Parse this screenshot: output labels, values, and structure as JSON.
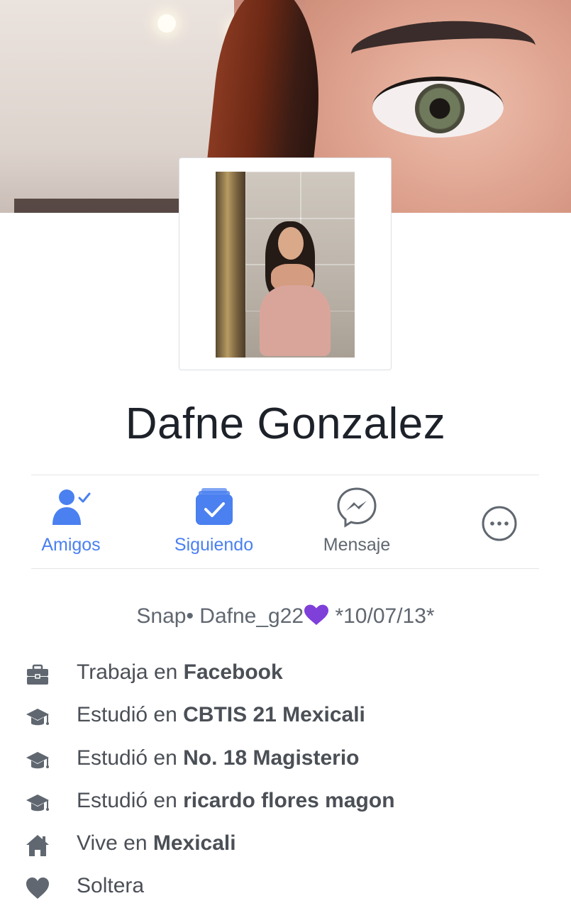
{
  "profile": {
    "name": "Dafne Gonzalez",
    "bio_prefix": "Snap• Dafne_g22",
    "bio_suffix": " *10/07/13*"
  },
  "actions": {
    "friends": "Amigos",
    "following": "Siguiendo",
    "message": "Mensaje"
  },
  "info": [
    {
      "icon": "briefcase-icon",
      "prefix": "Trabaja en ",
      "value": "Facebook"
    },
    {
      "icon": "graduation-cap-icon",
      "prefix": "Estudió en ",
      "value": "CBTIS 21 Mexicali"
    },
    {
      "icon": "graduation-cap-icon",
      "prefix": "Estudió en ",
      "value": "No. 18 Magisterio"
    },
    {
      "icon": "graduation-cap-icon",
      "prefix": "Estudió en ",
      "value": "ricardo flores magon"
    },
    {
      "icon": "home-icon",
      "prefix": "Vive en ",
      "value": "Mexicali"
    },
    {
      "icon": "heart-icon",
      "prefix": "Soltera",
      "value": ""
    }
  ],
  "colors": {
    "accent_blue": "#4a80f0",
    "icon_gray": "#606770",
    "text_gray": "#4b4f56",
    "heart_purple": "#7f3fd9"
  }
}
